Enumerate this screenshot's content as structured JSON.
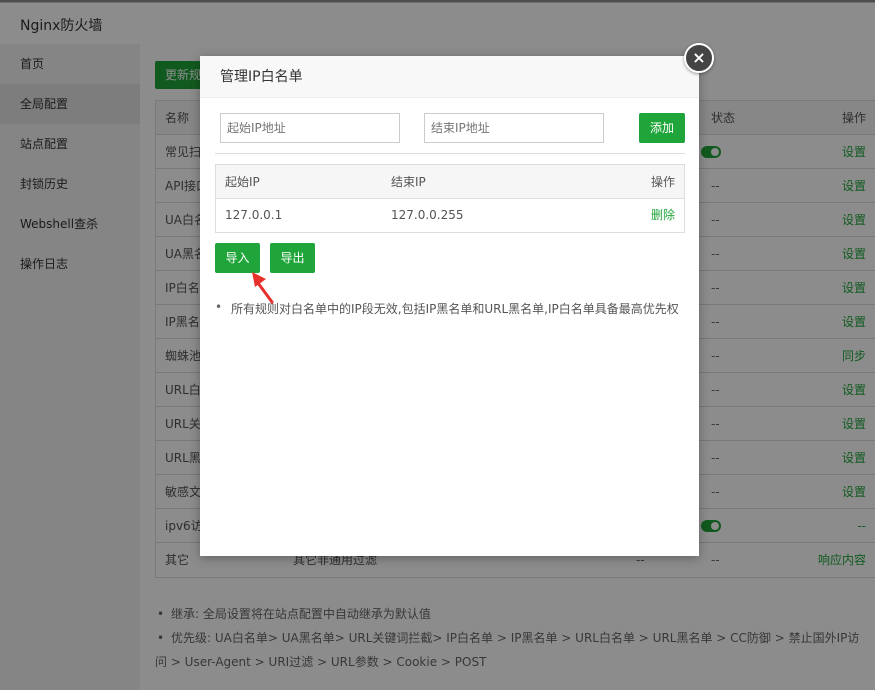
{
  "window": {
    "title": "Nginx防火墙"
  },
  "sidebar": {
    "items": [
      {
        "label": "首页"
      },
      {
        "label": "全局配置"
      },
      {
        "label": "站点配置"
      },
      {
        "label": "封锁历史"
      },
      {
        "label": "Webshell查杀"
      },
      {
        "label": "操作日志"
      }
    ],
    "active_index": 1
  },
  "main": {
    "update_button": "更新规",
    "table": {
      "headers": {
        "name": "名称",
        "status": "状态",
        "op": "操作"
      },
      "rows": [
        {
          "name": "常见扫",
          "status": "",
          "op": "设置"
        },
        {
          "name": "API接口",
          "status": "--",
          "op": "设置"
        },
        {
          "name": "UA白名",
          "status": "--",
          "op": "设置"
        },
        {
          "name": "UA黑名",
          "status": "--",
          "op": "设置"
        },
        {
          "name": "IP白名",
          "status": "--",
          "op": "设置"
        },
        {
          "name": "IP黑名",
          "status": "--",
          "op": "设置"
        },
        {
          "name": "蜘蛛池",
          "status": "--",
          "op": "同步"
        },
        {
          "name": "URL白名",
          "status": "--",
          "op": "设置"
        },
        {
          "name": "URL关",
          "status": "--",
          "op": "设置"
        },
        {
          "name": "URL黑",
          "status": "--",
          "op": "设置"
        },
        {
          "name": "敏感文",
          "status": "--",
          "op": "设置"
        },
        {
          "name": "ipv6访",
          "status": "",
          "op": "--"
        },
        {
          "name": "其它",
          "desc": "其它非通用过滤",
          "col_a": "--",
          "status": "--",
          "op": "响应内容"
        }
      ]
    },
    "notes": [
      "继承: 全局设置将在站点配置中自动继承为默认值",
      "优先级: UA白名单> UA黑名单> URL关键词拦截> IP白名单 > IP黑名单 > URL白名单 > URL黑名单 > CC防御 > 禁止国外IP访问 > User-Agent > URI过滤 > URL参数 > Cookie > POST"
    ]
  },
  "dialog": {
    "title": "管理IP白名单",
    "close_label": "×",
    "start_placeholder": "起始IP地址",
    "end_placeholder": "结束IP地址",
    "add_button": "添加",
    "table": {
      "headers": {
        "start": "起始IP",
        "end": "结束IP",
        "op": "操作"
      },
      "rows": [
        {
          "start": "127.0.0.1",
          "end": "127.0.0.255",
          "op": "删除"
        }
      ]
    },
    "import_button": "导入",
    "export_button": "导出",
    "note": "所有规则对白名单中的IP段无效,包括IP黑名单和URL黑名单,IP白名单具备最高优先权"
  },
  "colors": {
    "accent": "#20a53a",
    "annotation_arrow": "#e8302c"
  }
}
